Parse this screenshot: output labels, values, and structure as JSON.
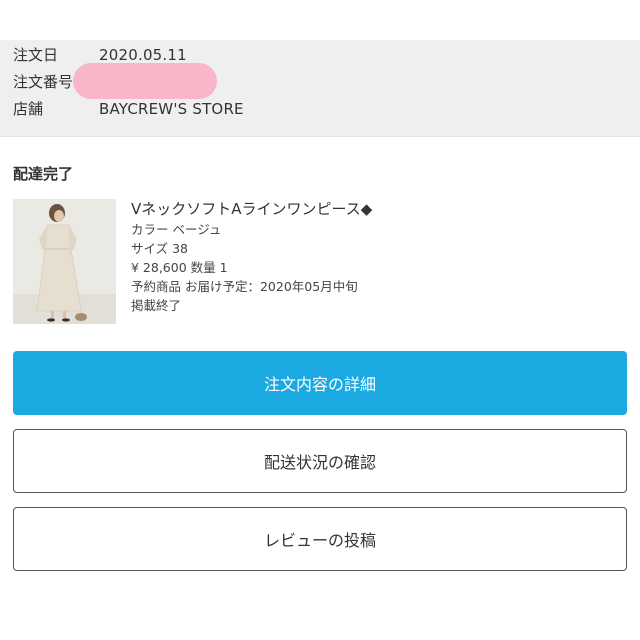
{
  "order": {
    "date_label": "注文日",
    "date_value": "2020.05.11",
    "number_label": "注文番号",
    "store_label": "店舗",
    "store_value": "BAYCREW'S STORE"
  },
  "status": "配達完了",
  "product": {
    "name": "VネックソフトAラインワンピース◆",
    "color": "カラー ベージュ",
    "size": "サイズ 38",
    "price_qty": "¥ 28,600 数量 1",
    "reservation": "予約商品 お届け予定：2020年05月中旬",
    "listing_status": "掲載終了"
  },
  "buttons": {
    "order_details": "注文内容の詳細",
    "shipping_status": "配送状況の確認",
    "post_review": "レビューの投稿"
  },
  "colors": {
    "primary": "#1ba9e1",
    "redaction": "#f8b6c8",
    "header_bg": "#efefef"
  }
}
